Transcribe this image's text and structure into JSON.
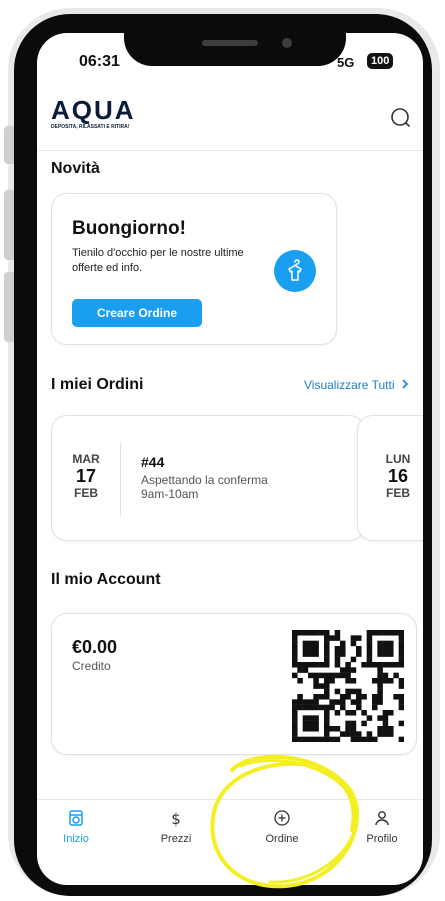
{
  "status_bar": {
    "time": "06:31",
    "network": "5G",
    "battery": "100"
  },
  "header": {
    "logo_text": "AQUA",
    "logo_tagline": "DEPOSITA, RILASSATI E RITIRA!",
    "search_icon": "search-icon"
  },
  "news": {
    "title": "Novità",
    "card": {
      "greeting": "Buongiorno!",
      "text": "Tienilo d'occhio per le nostre ultime offerte ed info.",
      "button_label": "Creare Ordine",
      "icon": "shirt-hanger-icon"
    }
  },
  "orders": {
    "title": "I miei Ordini",
    "view_all_label": "Visualizzare Tutti",
    "items": [
      {
        "dow": "MAR",
        "day": "17",
        "month": "FEB",
        "number": "#44",
        "status": "Aspettando la conferma",
        "time": "9am-10am"
      },
      {
        "dow": "LUN",
        "day": "16",
        "month": "FEB"
      }
    ]
  },
  "account": {
    "title": "Il mio Account",
    "credit_amount": "€0.00",
    "credit_label": "Credito",
    "qr_icon": "qr-code"
  },
  "tabbar": {
    "items": [
      {
        "label": "Inizio",
        "icon": "washer-icon",
        "active": true
      },
      {
        "label": "Prezzi",
        "icon": "dollar-icon",
        "active": false
      },
      {
        "label": "Ordine",
        "icon": "plus-circle-icon",
        "active": false
      },
      {
        "label": "Profilo",
        "icon": "person-icon",
        "active": false
      }
    ]
  },
  "colors": {
    "accent": "#1a9ff0",
    "link": "#1a7fd0",
    "highlight": "#f4ef22"
  }
}
